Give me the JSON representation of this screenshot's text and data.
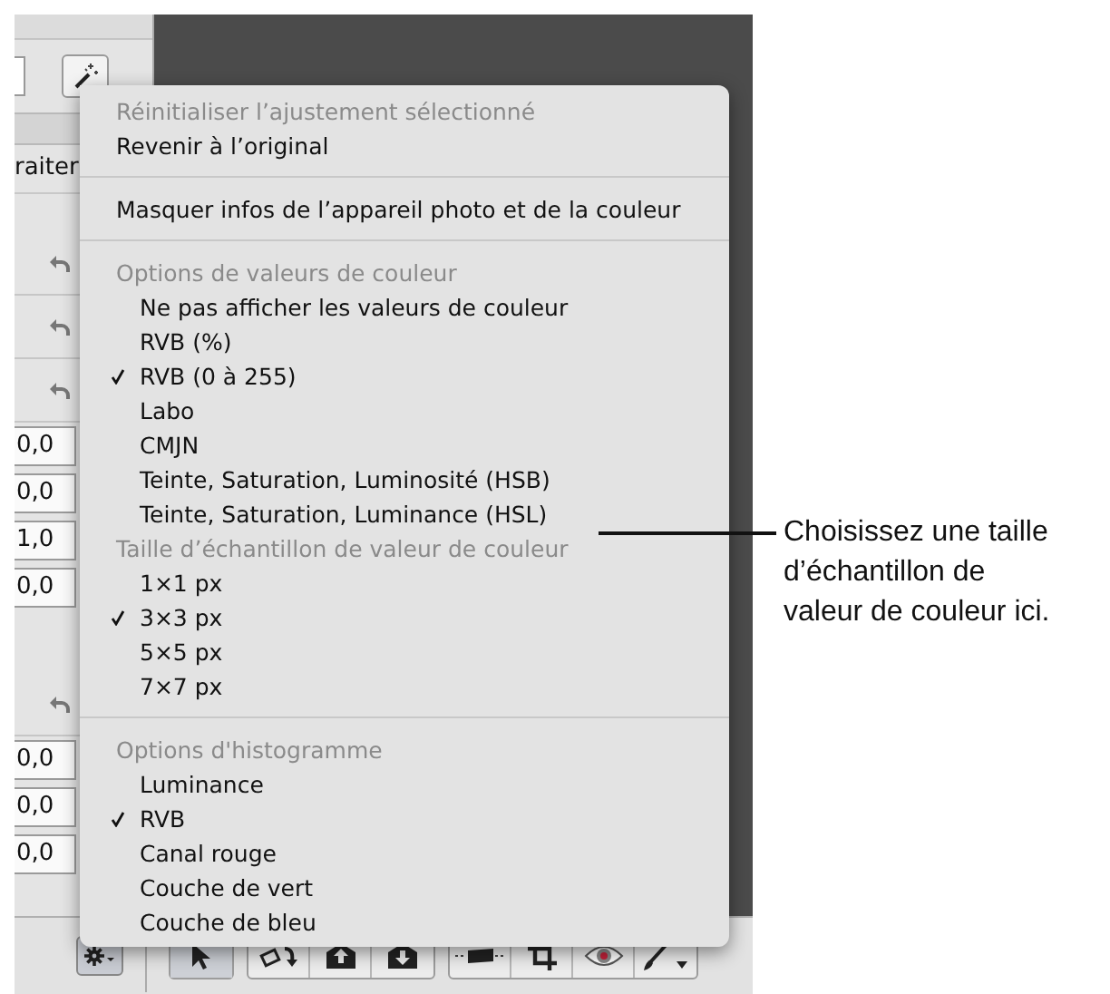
{
  "left_panel": {
    "column_label": "raiter",
    "rows": [
      {
        "kind": "undo"
      },
      {
        "kind": "undo"
      },
      {
        "kind": "undo"
      },
      {
        "kind": "value",
        "value": "0,0"
      },
      {
        "kind": "value",
        "value": "0,0"
      },
      {
        "kind": "value",
        "value": "1,0"
      },
      {
        "kind": "value",
        "value": "0,0"
      },
      {
        "kind": "undo"
      },
      {
        "kind": "value",
        "value": "0,0"
      },
      {
        "kind": "value",
        "value": "0,0"
      },
      {
        "kind": "value",
        "value": "0,0"
      }
    ]
  },
  "menu": {
    "items": [
      {
        "kind": "item",
        "label": "Réinitialiser l’ajustement sélectionné",
        "disabled": true
      },
      {
        "kind": "item",
        "label": "Revenir à l’original",
        "disabled": false
      },
      {
        "kind": "separator"
      },
      {
        "kind": "item",
        "label": "Masquer infos de l’appareil photo et de la couleur",
        "disabled": false
      },
      {
        "kind": "separator"
      },
      {
        "kind": "header",
        "label": "Options de valeurs de couleur"
      },
      {
        "kind": "option",
        "label": "Ne pas afficher les valeurs de couleur",
        "disabled": false,
        "checked": false
      },
      {
        "kind": "option",
        "label": "RVB (%)",
        "disabled": false,
        "checked": false
      },
      {
        "kind": "option",
        "label": "RVB (0 à 255)",
        "disabled": false,
        "checked": true
      },
      {
        "kind": "option",
        "label": "Labo",
        "disabled": false,
        "checked": false
      },
      {
        "kind": "option",
        "label": "CMJN",
        "disabled": false,
        "checked": false
      },
      {
        "kind": "option",
        "label": "Teinte, Saturation, Luminosité (HSB)",
        "disabled": false,
        "checked": false
      },
      {
        "kind": "option",
        "label": "Teinte, Saturation, Luminance (HSL)",
        "disabled": false,
        "checked": false
      },
      {
        "kind": "header",
        "label": "Taille d’échantillon de valeur de couleur"
      },
      {
        "kind": "option",
        "label": "1×1 px",
        "disabled": false,
        "checked": false
      },
      {
        "kind": "option",
        "label": "3×3 px",
        "disabled": false,
        "checked": true
      },
      {
        "kind": "option",
        "label": "5×5 px",
        "disabled": false,
        "checked": false
      },
      {
        "kind": "option",
        "label": "7×7 px",
        "disabled": false,
        "checked": false
      },
      {
        "kind": "separator"
      },
      {
        "kind": "header",
        "label": "Options d'histogramme"
      },
      {
        "kind": "option",
        "label": "Luminance",
        "disabled": false,
        "checked": false
      },
      {
        "kind": "option",
        "label": "RVB",
        "disabled": false,
        "checked": true
      },
      {
        "kind": "option",
        "label": "Canal rouge",
        "disabled": false,
        "checked": false
      },
      {
        "kind": "option",
        "label": "Couche de vert",
        "disabled": false,
        "checked": false
      },
      {
        "kind": "option",
        "label": "Couche de bleu",
        "disabled": false,
        "checked": false
      }
    ]
  },
  "toolbar": {
    "tools": [
      {
        "kind": "select",
        "selected": true
      },
      {
        "kind": "rotate",
        "selected": false
      },
      {
        "kind": "lift",
        "selected": false
      },
      {
        "kind": "stamp",
        "selected": false
      },
      {
        "kind": "straighten",
        "selected": false
      },
      {
        "kind": "crop",
        "selected": false
      },
      {
        "kind": "redeye",
        "selected": false
      },
      {
        "kind": "brush",
        "selected": false
      }
    ]
  },
  "callout": {
    "text": "Choisissez une taille d’échantillon de valeur de couleur ici."
  }
}
